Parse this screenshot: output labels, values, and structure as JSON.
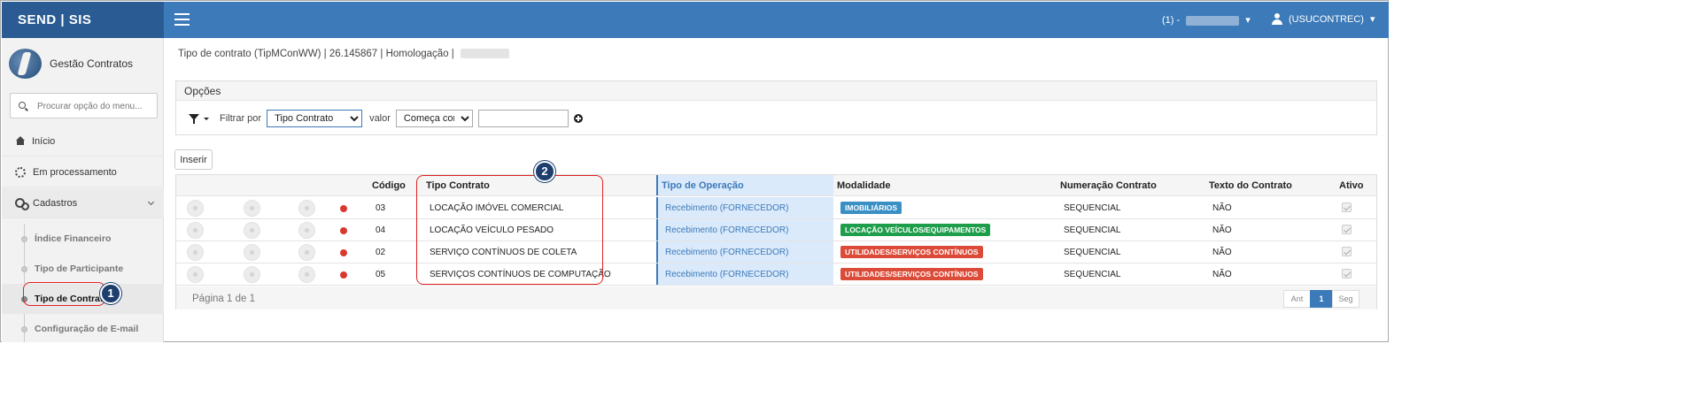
{
  "app": {
    "brand": "SEND | SIS",
    "module": "Gestão Contratos"
  },
  "topbar": {
    "context_prefix": "(1) -",
    "user_label": "(USUCONTREC)"
  },
  "sidebar": {
    "search_placeholder": "Procurar opção do menu...",
    "items": [
      {
        "label": "Início",
        "icon": "home-icon"
      },
      {
        "label": "Em processamento",
        "icon": "spinner-icon"
      },
      {
        "label": "Cadastros",
        "icon": "gears-icon"
      }
    ],
    "subitems": [
      "Índice Financeiro",
      "Tipo de Participante",
      "Tipo de Contrato",
      "Configuração de E-mail"
    ],
    "active_subitem": "Tipo de Contrato"
  },
  "breadcrumb": "Tipo de contrato (TipMConWW) | 26.145867 | Homologação |",
  "options": {
    "title": "Opções",
    "filter_label": "Filtrar por",
    "filter_field": "Tipo Contrato",
    "value_label": "valor",
    "operator": "Começa com",
    "value": ""
  },
  "insert_label": "Inserir",
  "grid": {
    "headers": [
      "Código",
      "Tipo Contrato",
      "Tipo de Operação",
      "Modalidade",
      "Numeração Contrato",
      "Texto do Contrato",
      "Ativo"
    ],
    "rows": [
      {
        "codigo": "03",
        "tipo": "LOCAÇÃO IMÓVEL COMERCIAL",
        "operacao": "Recebimento (FORNECEDOR)",
        "modalidade": "IMOBILIÁRIOS",
        "modalidade_color": "#3a8fc4",
        "numeracao": "SEQUENCIAL",
        "texto": "NÃO"
      },
      {
        "codigo": "04",
        "tipo": "LOCAÇÃO VEÍCULO PESADO",
        "operacao": "Recebimento (FORNECEDOR)",
        "modalidade": "LOCAÇÃO VEÍCULOS/EQUIPAMENTOS",
        "modalidade_color": "#1e9e4a",
        "numeracao": "SEQUENCIAL",
        "texto": "NÃO"
      },
      {
        "codigo": "02",
        "tipo": "SERVIÇO CONTÍNUOS DE COLETA",
        "operacao": "Recebimento (FORNECEDOR)",
        "modalidade": "UTILIDADES/SERVIÇOS CONTÍNUOS",
        "modalidade_color": "#dc4a38",
        "numeracao": "SEQUENCIAL",
        "texto": "NÃO"
      },
      {
        "codigo": "05",
        "tipo": "SERVIÇOS CONTÍNUOS DE COMPUTAÇÃO",
        "operacao": "Recebimento (FORNECEDOR)",
        "modalidade": "UTILIDADES/SERVIÇOS CONTÍNUOS",
        "modalidade_color": "#dc4a38",
        "numeracao": "SEQUENCIAL",
        "texto": "NÃO"
      }
    ],
    "status_color": "#d9382f",
    "page_info": "Página 1 de 1",
    "pager": {
      "prev": "Ant",
      "current": "1",
      "next": "Seg"
    }
  },
  "callouts": [
    "1",
    "2"
  ],
  "colors": {
    "topbar": "#3c7ab9",
    "brand_bg": "#2a5c93",
    "callout": "#e02020",
    "badge": "#1e3f6e"
  }
}
